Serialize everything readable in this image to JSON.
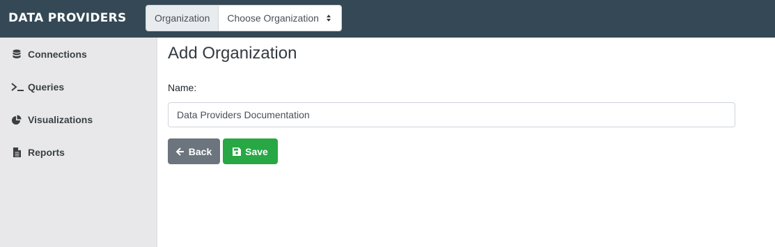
{
  "header": {
    "brand": "DATA PROVIDERS",
    "org_label": "Organization",
    "org_select_value": "Choose Organization"
  },
  "sidebar": {
    "items": [
      {
        "label": "Connections",
        "icon": "database-icon"
      },
      {
        "label": "Queries",
        "icon": "terminal-icon"
      },
      {
        "label": "Visualizations",
        "icon": "pie-chart-icon"
      },
      {
        "label": "Reports",
        "icon": "file-icon"
      }
    ]
  },
  "main": {
    "title": "Add Organization",
    "name_label": "Name:",
    "name_value": "Data Providers Documentation",
    "back_label": "Back",
    "save_label": "Save"
  },
  "colors": {
    "header_bg": "#344955",
    "sidebar_bg": "#e8e8ea",
    "back_button": "#6c757d",
    "save_button": "#28a745"
  }
}
